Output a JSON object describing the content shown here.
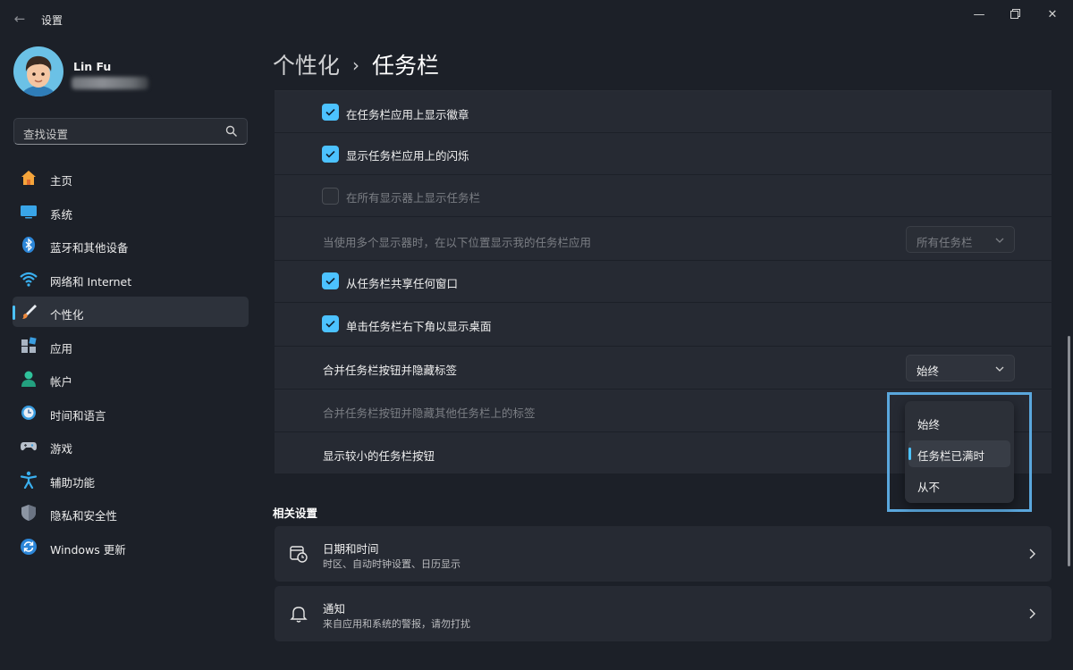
{
  "app": {
    "title": "设置",
    "back_icon": "back-arrow-icon",
    "window_controls": [
      "minimize-icon",
      "restore-icon",
      "close-icon"
    ]
  },
  "user": {
    "name": "Lin Fu"
  },
  "search": {
    "placeholder": "查找设置"
  },
  "sidebar": {
    "items": [
      {
        "label": "主页",
        "icon": "home-icon"
      },
      {
        "label": "系统",
        "icon": "system-icon"
      },
      {
        "label": "蓝牙和其他设备",
        "icon": "bluetooth-icon"
      },
      {
        "label": "网络和 Internet",
        "icon": "wifi-icon"
      },
      {
        "label": "个性化",
        "icon": "brush-icon",
        "selected": true
      },
      {
        "label": "应用",
        "icon": "apps-icon"
      },
      {
        "label": "帐户",
        "icon": "account-icon"
      },
      {
        "label": "时间和语言",
        "icon": "time-language-icon"
      },
      {
        "label": "游戏",
        "icon": "gamepad-icon"
      },
      {
        "label": "辅助功能",
        "icon": "accessibility-icon"
      },
      {
        "label": "隐私和安全性",
        "icon": "shield-icon"
      },
      {
        "label": "Windows 更新",
        "icon": "update-icon"
      }
    ]
  },
  "header": {
    "parent": "个性化",
    "separator": "›",
    "current": "任务栏"
  },
  "settings": {
    "show_badges": {
      "label": "在任务栏应用上显示徽章",
      "checked": true
    },
    "show_flashing": {
      "label": "显示任务栏应用上的闪烁",
      "checked": true
    },
    "all_displays": {
      "label": "在所有显示器上显示任务栏",
      "checked": false,
      "disabled": true
    },
    "multi_display": {
      "label": "当使用多个显示器时，在以下位置显示我的任务栏应用",
      "value": "所有任务栏",
      "disabled": true
    },
    "share_window": {
      "label": "从任务栏共享任何窗口",
      "checked": true
    },
    "show_desktop": {
      "label": "单击任务栏右下角以显示桌面",
      "checked": true
    },
    "combine_buttons": {
      "label": "合并任务栏按钮并隐藏标签",
      "value": "始终"
    },
    "combine_other": {
      "label": "合并任务栏按钮并隐藏其他任务栏上的标签",
      "disabled": true
    },
    "small_buttons": {
      "label": "显示较小的任务栏按钮"
    }
  },
  "dropdown": {
    "options": [
      "始终",
      "任务栏已满时",
      "从不"
    ],
    "selected_index": 1
  },
  "related": {
    "title": "相关设置",
    "items": [
      {
        "title": "日期和时间",
        "subtitle": "时区、自动时钟设置、日历显示",
        "icon": "calendar-clock-icon"
      },
      {
        "title": "通知",
        "subtitle": "来自应用和系统的警报，请勿打扰",
        "icon": "bell-icon"
      }
    ]
  },
  "colors": {
    "accent": "#4cc2ff",
    "background": "#1c2028",
    "card": "#262a33",
    "highlight_box": "#5aa7dd"
  }
}
